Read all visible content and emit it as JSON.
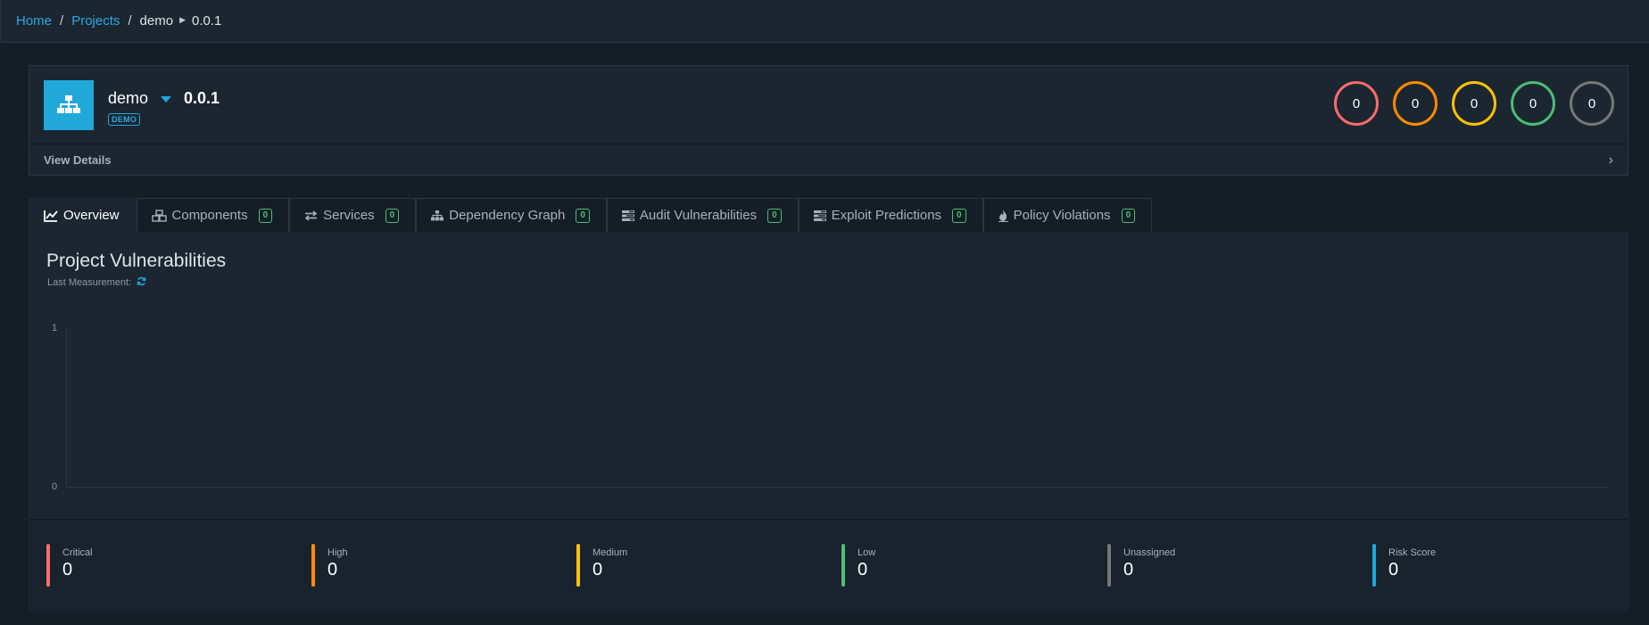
{
  "breadcrumb": {
    "home": "Home",
    "projects": "Projects",
    "project": "demo",
    "version": "0.0.1"
  },
  "project": {
    "name": "demo",
    "version": "0.0.1",
    "tag": "DEMO",
    "view_details": "View Details",
    "severity_counts": [
      {
        "name": "critical",
        "value": "0",
        "color": "#f86c6b"
      },
      {
        "name": "high",
        "value": "0",
        "color": "#fd8c00"
      },
      {
        "name": "medium",
        "value": "0",
        "color": "#ffc107"
      },
      {
        "name": "low",
        "value": "0",
        "color": "#4dbd74"
      },
      {
        "name": "unassigned",
        "value": "0",
        "color": "#777777"
      }
    ]
  },
  "tabs": [
    {
      "label": "Overview",
      "icon": "line-chart-icon",
      "badge": null,
      "active": true
    },
    {
      "label": "Components",
      "icon": "cubes-icon",
      "badge": "0",
      "active": false
    },
    {
      "label": "Services",
      "icon": "exchange-icon",
      "badge": "0",
      "active": false
    },
    {
      "label": "Dependency Graph",
      "icon": "sitemap-icon",
      "badge": "0",
      "active": false
    },
    {
      "label": "Audit Vulnerabilities",
      "icon": "tasks-icon",
      "badge": "0",
      "active": false
    },
    {
      "label": "Exploit Predictions",
      "icon": "tasks-icon",
      "badge": "0",
      "active": false
    },
    {
      "label": "Policy Violations",
      "icon": "fire-icon",
      "badge": "0",
      "active": false
    }
  ],
  "overview": {
    "title": "Project Vulnerabilities",
    "last_measurement_label": "Last Measurement:",
    "chart": {
      "y_ticks": [
        "1",
        "0"
      ]
    },
    "stats": [
      {
        "label": "Critical",
        "value": "0",
        "color": "#f86c6b"
      },
      {
        "label": "High",
        "value": "0",
        "color": "#fd8c00"
      },
      {
        "label": "Medium",
        "value": "0",
        "color": "#ffc107"
      },
      {
        "label": "Low",
        "value": "0",
        "color": "#4dbd74"
      },
      {
        "label": "Unassigned",
        "value": "0",
        "color": "#777777"
      },
      {
        "label": "Risk Score",
        "value": "0",
        "color": "#20a8d8"
      }
    ]
  }
}
